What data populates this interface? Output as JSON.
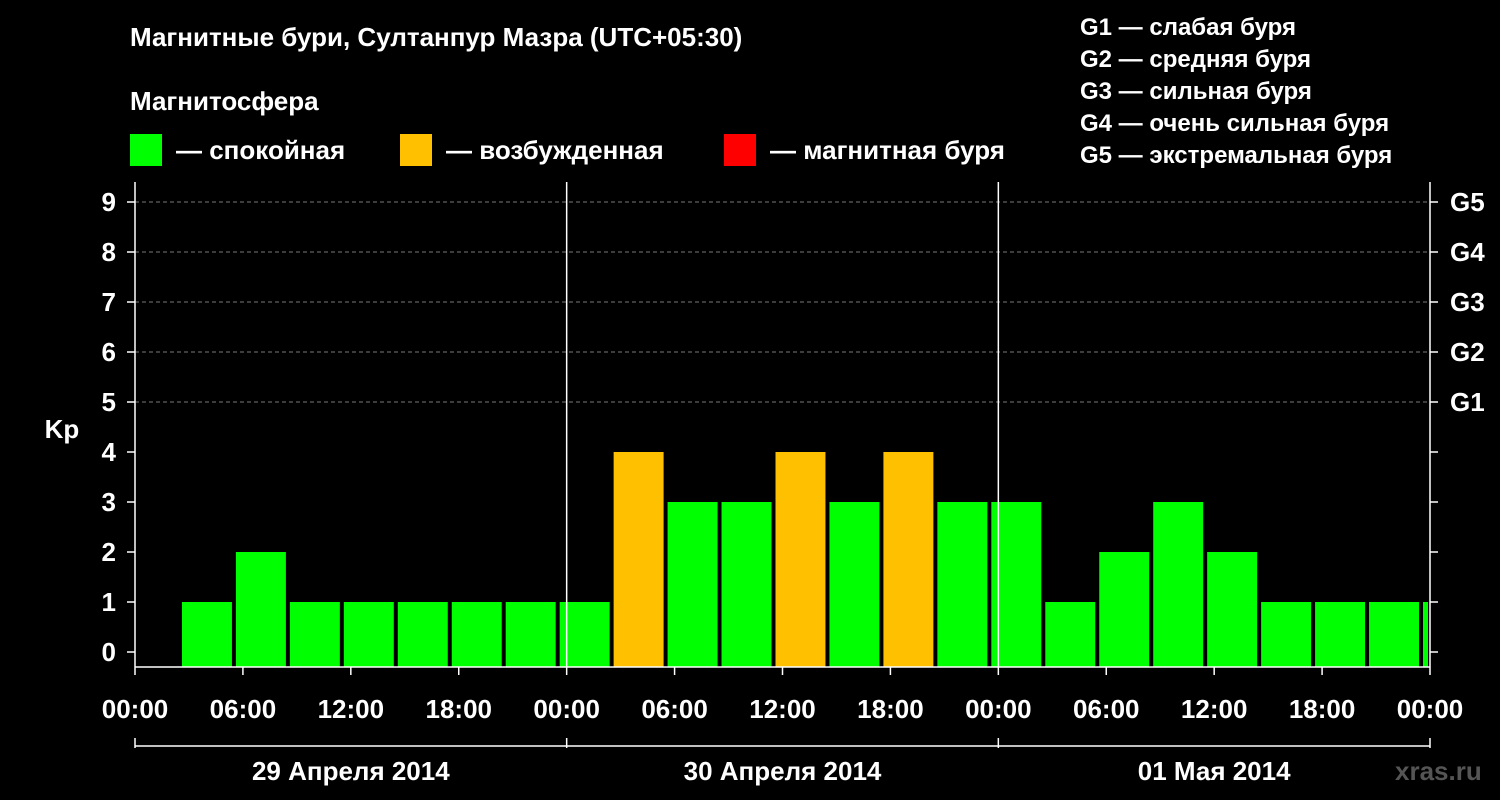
{
  "header": {
    "title": "Магнитные бури, Султанпур Мазра (UTC+05:30)",
    "subtitle": "Магнитосфера"
  },
  "legend": [
    {
      "label": "— спокойная",
      "color": "#00ff00"
    },
    {
      "label": "— возбужденная",
      "color": "#ffc000"
    },
    {
      "label": "— магнитная буря",
      "color": "#ff0000"
    }
  ],
  "g_scale": [
    "G1 — слабая буря",
    "G2 — средняя буря",
    "G3 — сильная буря",
    "G4 — очень сильная буря",
    "G5 — экстремальная буря"
  ],
  "watermark": "xras.ru",
  "chart_data": {
    "type": "bar",
    "ylabel": "Kp",
    "ylim": [
      0,
      9
    ],
    "grid": "dashed horizontal at 5–9",
    "y_ticks": [
      "0",
      "1",
      "2",
      "3",
      "4",
      "5",
      "6",
      "7",
      "8",
      "9"
    ],
    "right_ticks": [
      {
        "value": 5,
        "label": "G1"
      },
      {
        "value": 6,
        "label": "G2"
      },
      {
        "value": 7,
        "label": "G3"
      },
      {
        "value": 8,
        "label": "G4"
      },
      {
        "value": 9,
        "label": "G5"
      }
    ],
    "x_ticks": [
      "00:00",
      "06:00",
      "12:00",
      "18:00",
      "00:00",
      "06:00",
      "12:00",
      "18:00",
      "00:00",
      "06:00",
      "12:00",
      "18:00",
      "00:00"
    ],
    "days": [
      "29 Апреля 2014",
      "30 Апреля 2014",
      "01 Мая 2014"
    ],
    "interval_hours": 3,
    "first_bar_start_hour": 2.5,
    "values": [
      1,
      2,
      1,
      1,
      1,
      1,
      1,
      1,
      4,
      3,
      3,
      4,
      3,
      4,
      3,
      3,
      1,
      2,
      3,
      2,
      1,
      1,
      1,
      1
    ],
    "colors": {
      "quiet": "#00ff00",
      "active": "#ffc000",
      "storm": "#ff0000"
    }
  }
}
